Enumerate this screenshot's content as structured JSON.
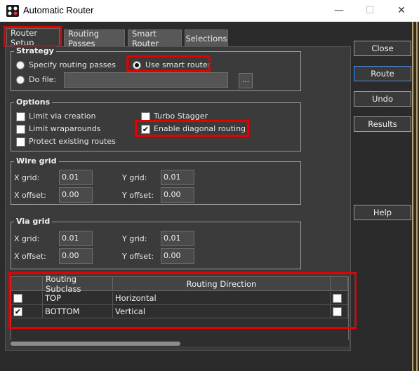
{
  "window": {
    "title": "Automatic Router",
    "minimize": "—",
    "maximize": "☐",
    "close": "✕"
  },
  "tabs": [
    "Router Setup",
    "Routing Passes",
    "Smart Router",
    "Selections"
  ],
  "strategy": {
    "label": "Strategy",
    "specify_passes": "Specify routing passes",
    "use_smart": "Use smart router",
    "do_file": "Do file:",
    "do_file_value": "",
    "browse": "...",
    "selected": "use_smart"
  },
  "options": {
    "label": "Options",
    "limit_via": {
      "label": "Limit via creation",
      "checked": false
    },
    "limit_wrap": {
      "label": "Limit wraparounds",
      "checked": false
    },
    "protect": {
      "label": "Protect existing routes",
      "checked": false
    },
    "turbo": {
      "label": "Turbo Stagger",
      "checked": false
    },
    "diagonal": {
      "label": "Enable diagonal routing",
      "checked": true
    }
  },
  "wire_grid": {
    "label": "Wire grid",
    "x_grid_label": "X grid:",
    "x_grid": "0.01",
    "y_grid_label": "Y grid:",
    "y_grid": "0.01",
    "x_offset_label": "X offset:",
    "x_offset": "0.00",
    "y_offset_label": "Y offset:",
    "y_offset": "0.00"
  },
  "via_grid": {
    "label": "Via grid",
    "x_grid_label": "X grid:",
    "x_grid": "0.01",
    "y_grid_label": "Y grid:",
    "y_grid": "0.01",
    "x_offset_label": "X offset:",
    "x_offset": "0.00",
    "y_offset_label": "Y offset:",
    "y_offset": "0.00"
  },
  "buttons": {
    "close": "Close",
    "route": "Route",
    "undo": "Undo",
    "results": "Results",
    "help": "Help"
  },
  "table": {
    "headers": [
      "",
      "Routing Subclass",
      "Routing Direction",
      ""
    ],
    "rows": [
      {
        "enabled": false,
        "subclass": "TOP",
        "direction": "Horizontal",
        "extra": false
      },
      {
        "enabled": true,
        "subclass": "BOTTOM",
        "direction": "Vertical",
        "extra": false
      }
    ]
  },
  "colors": {
    "highlight": "#e30000",
    "panel": "#3b3b3b",
    "background": "#2b2b2b",
    "accent": "#4a90e2"
  }
}
